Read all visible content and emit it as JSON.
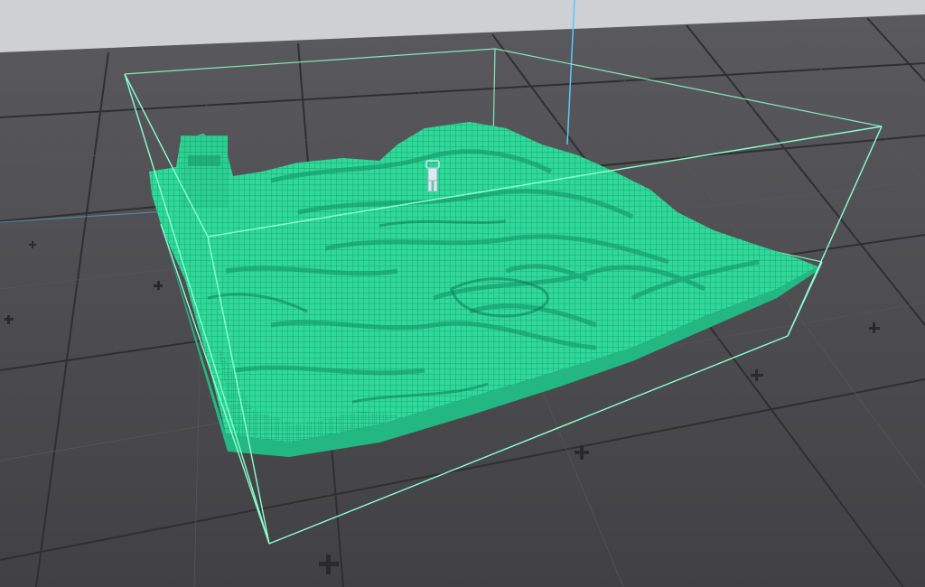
{
  "viewport": {
    "colors": {
      "sky": "#cfd0d4",
      "floor": "#4b4b4e",
      "grid_major": "#2e2e30",
      "grid_minor": "#565659",
      "voxel_fill": "#2fd99a",
      "voxel_dark": "#1a9a6c",
      "bounds_outline": "#7dffc3",
      "axis_line": "#58c8ff"
    },
    "icons": {
      "grid_marker": "plus-marker-icon",
      "player": "player-figure-icon"
    }
  }
}
